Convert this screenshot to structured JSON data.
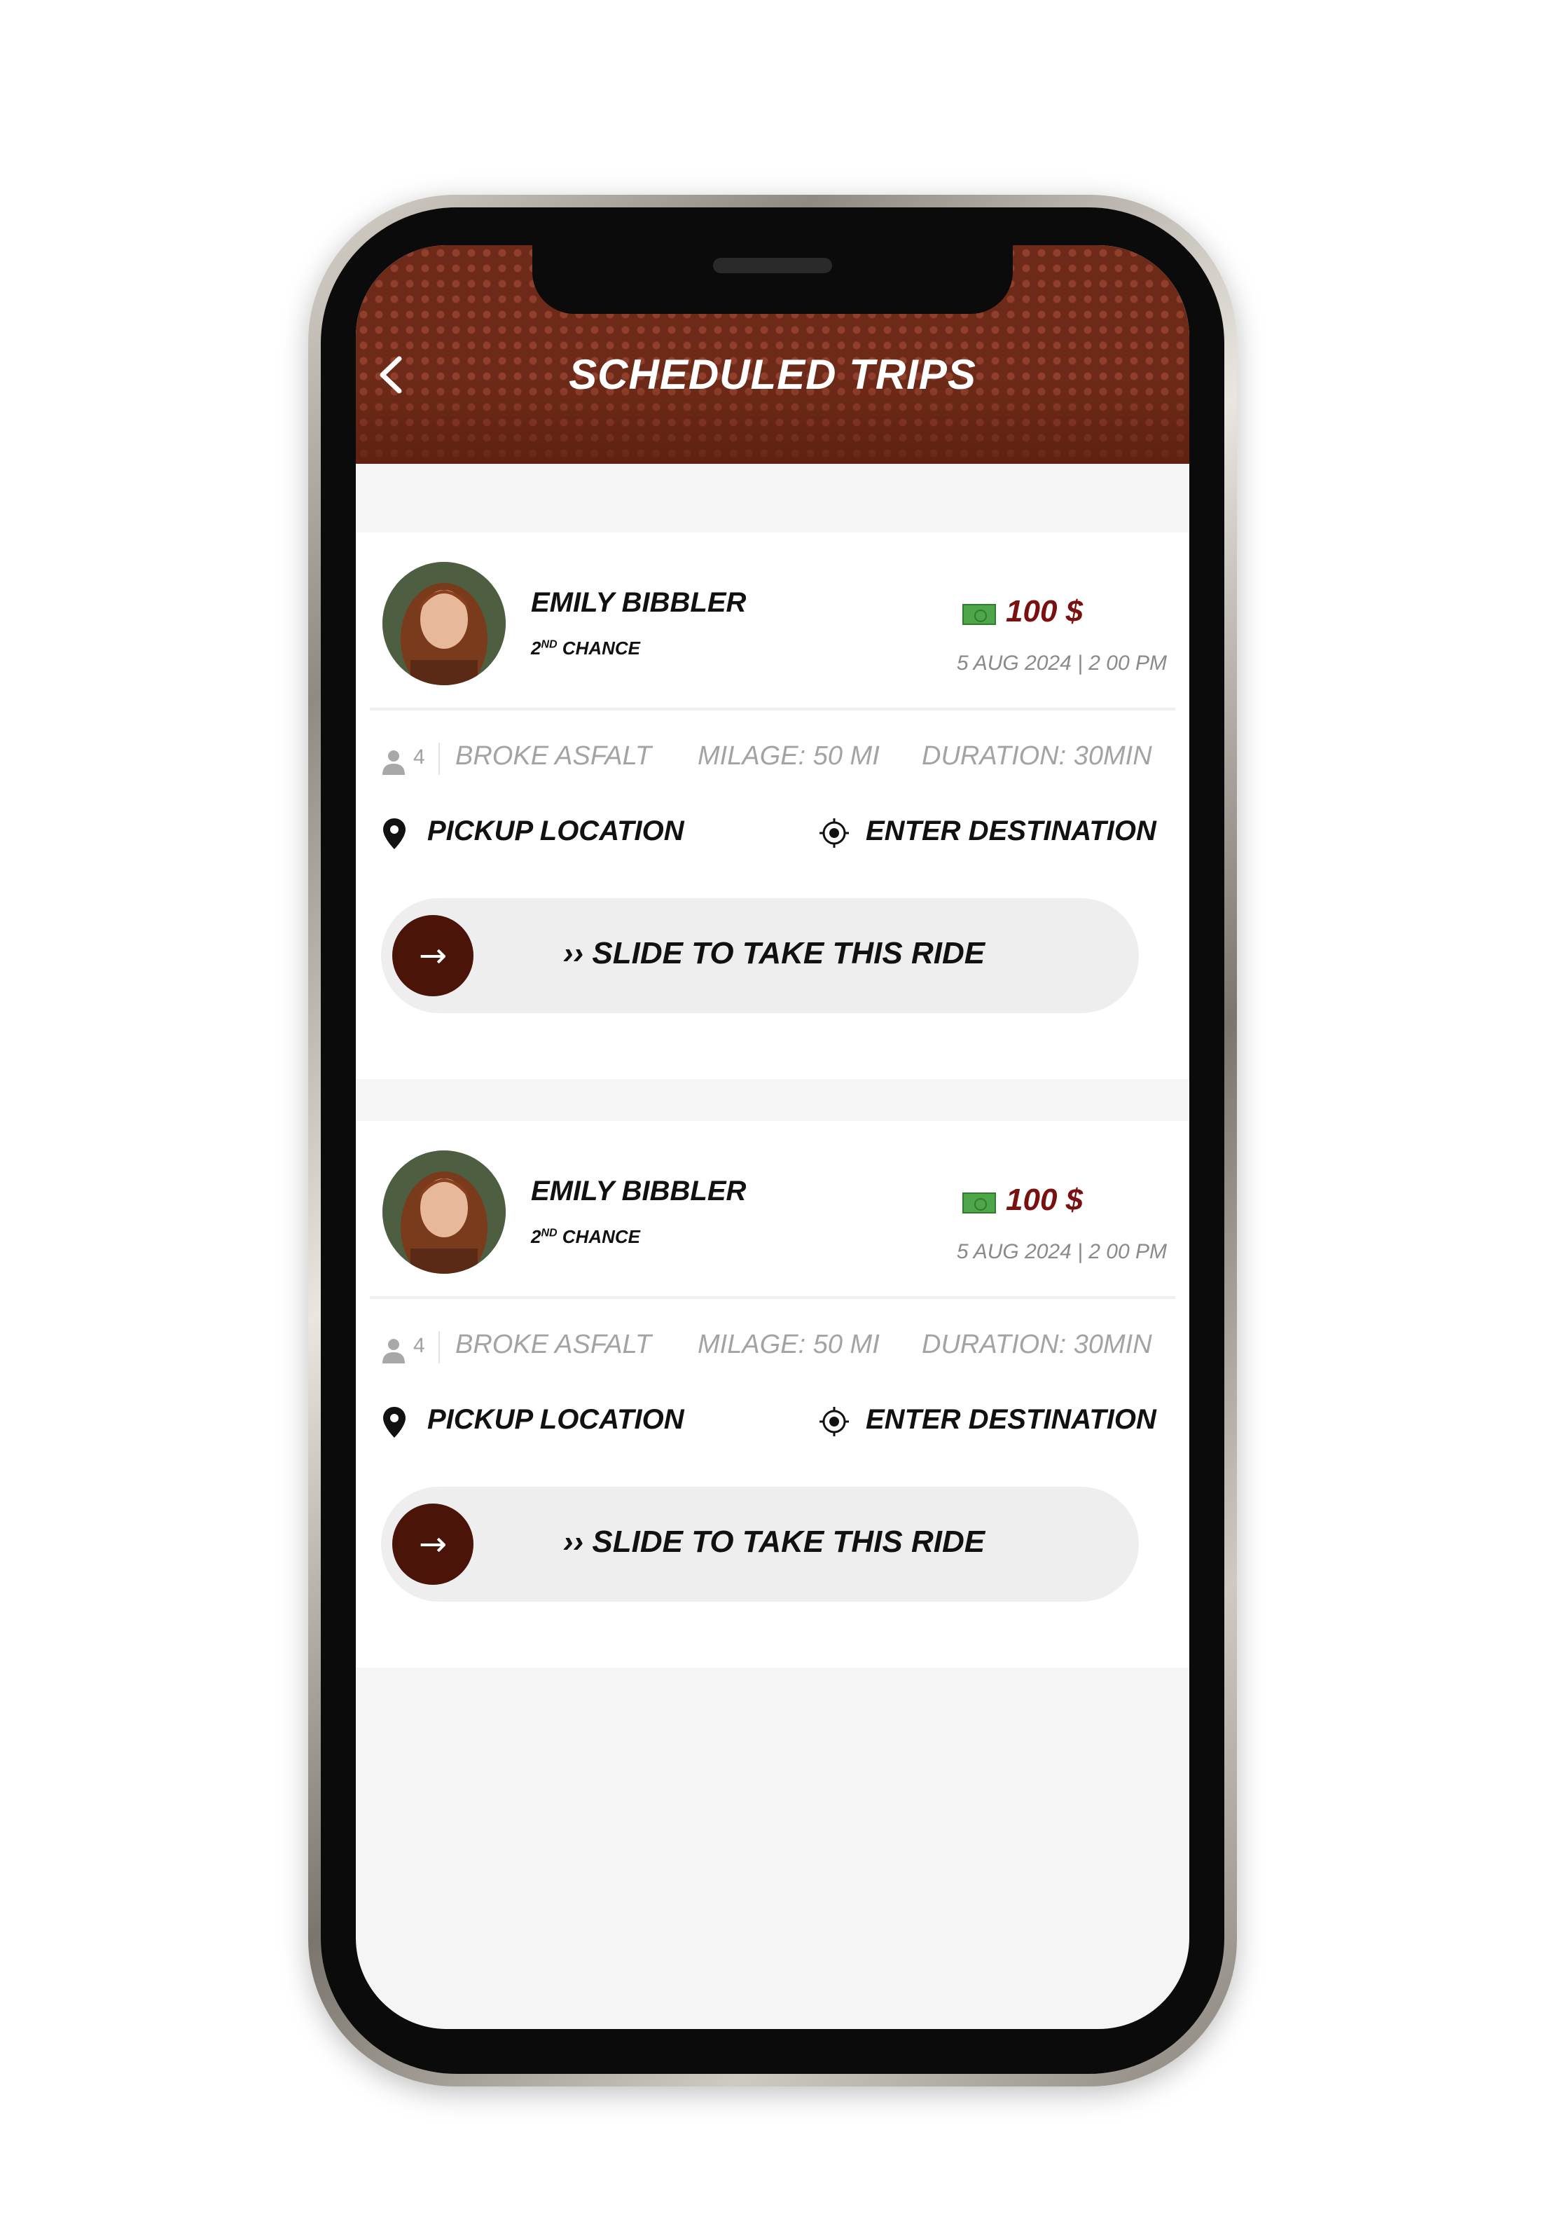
{
  "header": {
    "title": "SCHEDULED TRIPS",
    "back_glyph": "‹",
    "back_icon": "chevron-left-icon",
    "background_color": "#6e2a18"
  },
  "trips": [
    {
      "driver_name": "EMILY BIBBLER",
      "tag_prefix": "2",
      "tag_superscript": "ND",
      "tag_suffix": " CHANCE",
      "fare": "100 $",
      "datetime": "5 AUG 2024 | 2 00 PM",
      "passengers": "4",
      "vehicle": "BROKE ASFALT",
      "milage": "MILAGE: 50 MI",
      "duration": "DURATION: 30MIN",
      "pickup": "PICKUP LOCATION",
      "destination": "ENTER DESTINATION",
      "slide_label": "›› SLIDE TO TAKE THIS RIDE",
      "slide_glyph": "→"
    },
    {
      "driver_name": "EMILY BIBBLER",
      "tag_prefix": "2",
      "tag_superscript": "ND",
      "tag_suffix": " CHANCE",
      "fare": "100 $",
      "datetime": "5 AUG 2024 | 2 00 PM",
      "passengers": "4",
      "vehicle": "BROKE ASFALT",
      "milage": "MILAGE: 50 MI",
      "duration": "DURATION: 30MIN",
      "pickup": "PICKUP LOCATION",
      "destination": "ENTER DESTINATION",
      "slide_label": "›› SLIDE TO TAKE THIS RIDE",
      "slide_glyph": "→"
    }
  ],
  "colors": {
    "accent_dark": "#4a1408",
    "fare": "#7a1010",
    "cash": "#4fa64a"
  }
}
